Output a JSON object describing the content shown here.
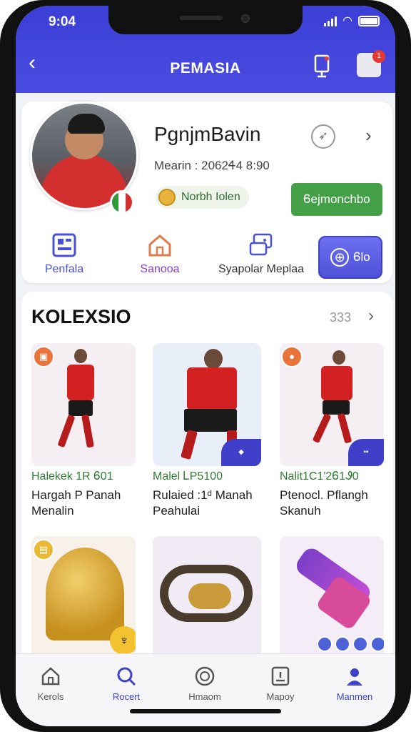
{
  "status_bar": {
    "time": "9:04"
  },
  "header": {
    "title": "PEMASIA",
    "badge": "1"
  },
  "profile": {
    "name": "PgnjmBavin",
    "subtitle": "Mearin : 2062Ꮞ4 8:90",
    "tag": "Norbh Iolen",
    "action_label": "Ꮾejmonchbo"
  },
  "quick_actions": [
    {
      "label": "Penfala",
      "color": "#4a4fd8",
      "icon": "grid-icon"
    },
    {
      "label": "Sanooa",
      "color": "#8e3fc0",
      "icon": "home-icon"
    },
    {
      "label": "Syapolar Meplaa",
      "color": "#333333",
      "icon": "chat-icon"
    }
  ],
  "primary_action": {
    "label": "Ꮾlo"
  },
  "collection": {
    "title": "KOLEXSIO",
    "count": "333",
    "items": [
      {
        "line1": "Halekek 1R Ꮾ01",
        "line2": "Hargah P Panah",
        "line3": "Menalin"
      },
      {
        "line1": "Malel ᏞP5100",
        "line2": "Rulaied :1ᵈ Manah",
        "line3": "Peahulai"
      },
      {
        "line1": "Nalit1C1'2Ꮾ1Ꮽ0",
        "line2": "Ptenocl. Pflangh",
        "line3": "Skanuh"
      }
    ]
  },
  "bottom_nav": [
    {
      "label": "Kerols",
      "icon": "home-icon"
    },
    {
      "label": "Rocert",
      "icon": "search-icon"
    },
    {
      "label": "Hmaom",
      "icon": "trophy-icon"
    },
    {
      "label": "Mapoy",
      "icon": "card-icon"
    },
    {
      "label": "Manmen",
      "icon": "user-icon"
    }
  ]
}
